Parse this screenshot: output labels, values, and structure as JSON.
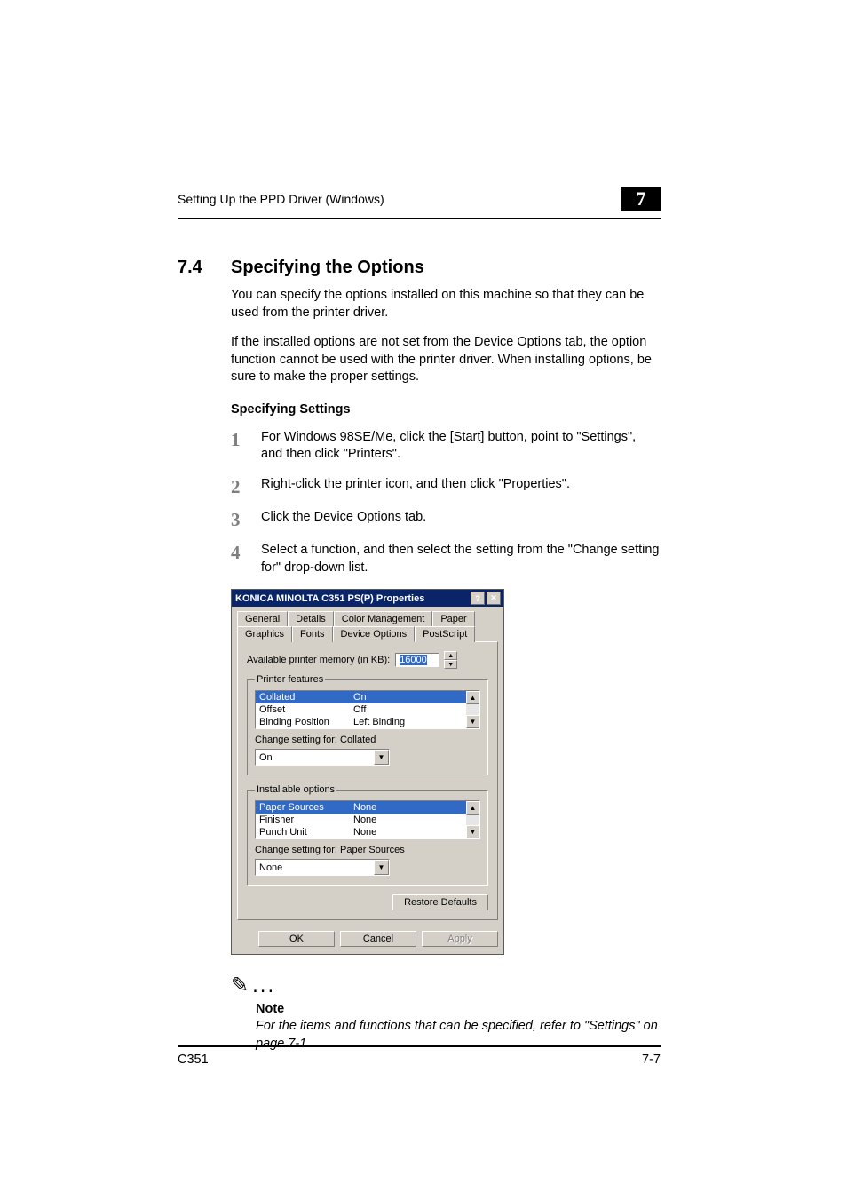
{
  "header": {
    "running_title": "Setting Up the PPD Driver (Windows)",
    "chapter_number": "7"
  },
  "section": {
    "number": "7.4",
    "title": "Specifying the Options",
    "para1": "You can specify the options installed on this machine so that they can be used from the printer driver.",
    "para2": "If the installed options are not set from the Device Options tab, the option function cannot be used with the printer driver. When installing options, be sure to make the proper settings.",
    "sub_heading": "Specifying Settings"
  },
  "steps": [
    {
      "num": "1",
      "text": "For Windows 98SE/Me, click the [Start] button, point to \"Settings\", and then click \"Printers\"."
    },
    {
      "num": "2",
      "text": "Right-click the printer icon, and then click \"Properties\"."
    },
    {
      "num": "3",
      "text": "Click the Device Options tab."
    },
    {
      "num": "4",
      "text": "Select a function, and then select the setting from the \"Change setting for\" drop-down list."
    }
  ],
  "dialog": {
    "title": "KONICA MINOLTA C351 PS(P) Properties",
    "tabs_row1": [
      "General",
      "Details",
      "Color Management",
      "Paper"
    ],
    "tabs_row2": [
      "Graphics",
      "Fonts",
      "Device Options",
      "PostScript"
    ],
    "active_tab": "Device Options",
    "mem_label": "Available printer memory (in KB):",
    "mem_value": "16000",
    "features_legend": "Printer features",
    "features": [
      {
        "name": "Collated",
        "value": "On"
      },
      {
        "name": "Offset",
        "value": "Off"
      },
      {
        "name": "Binding Position",
        "value": "Left Binding"
      }
    ],
    "features_change_label": "Change setting for: Collated",
    "features_change_value": "On",
    "install_legend": "Installable options",
    "install_opts": [
      {
        "name": "Paper Sources",
        "value": "None"
      },
      {
        "name": "Finisher",
        "value": "None"
      },
      {
        "name": "Punch Unit",
        "value": "None"
      }
    ],
    "install_change_label": "Change setting for: Paper Sources",
    "install_change_value": "None",
    "restore_btn": "Restore Defaults",
    "ok": "OK",
    "cancel": "Cancel",
    "apply": "Apply"
  },
  "note": {
    "symbol": "✎",
    "heading": "Note",
    "body": "For the items and functions that can be specified, refer to \"Settings\" on page 7-1."
  },
  "footer": {
    "model": "C351",
    "page": "7-7"
  }
}
